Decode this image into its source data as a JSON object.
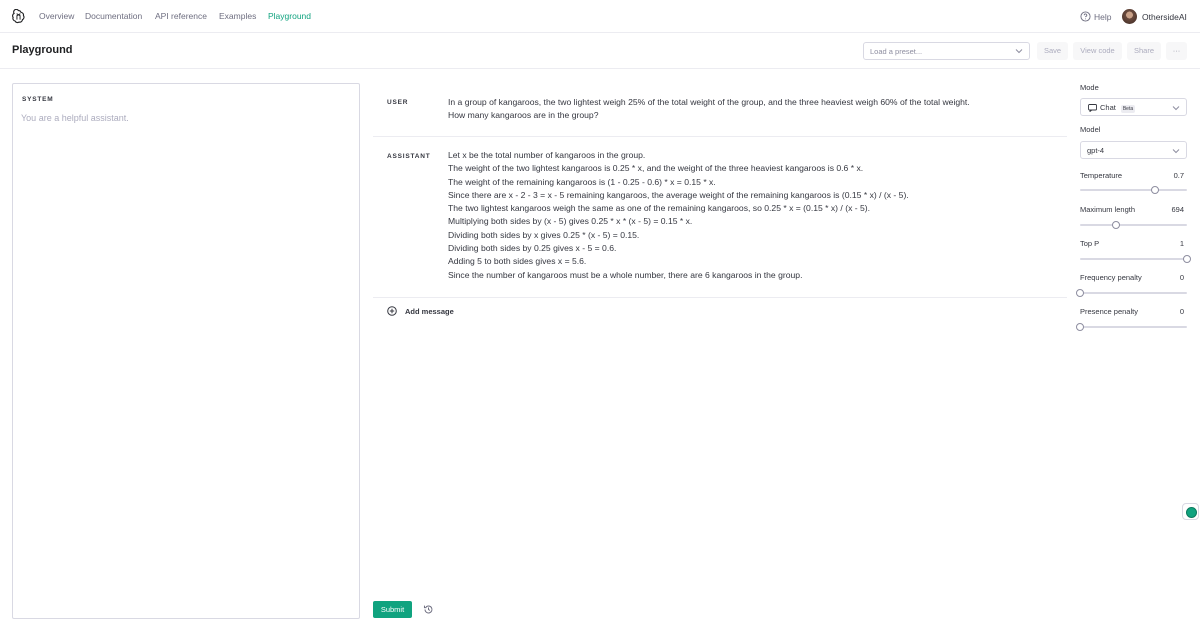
{
  "nav": {
    "links": [
      "Overview",
      "Documentation",
      "API reference",
      "Examples",
      "Playground"
    ],
    "help": "Help",
    "org": "OthersideAI"
  },
  "header": {
    "title": "Playground",
    "preset_placeholder": "Load a preset...",
    "save": "Save",
    "view_code": "View code",
    "share": "Share",
    "more": "···"
  },
  "system": {
    "label": "SYSTEM",
    "placeholder": "You are a helpful assistant."
  },
  "messages": [
    {
      "role": "USER",
      "lines": [
        "In a group of kangaroos, the two lightest weigh 25% of the total weight of the group, and the three heaviest weigh 60% of the total weight.",
        "How many kangaroos are in the group?"
      ]
    },
    {
      "role": "ASSISTANT",
      "lines": [
        "Let x be the total number of kangaroos in the group.",
        "The weight of the two lightest kangaroos is 0.25 * x, and the weight of the three heaviest kangaroos is 0.6 * x.",
        "The weight of the remaining kangaroos is (1 - 0.25 - 0.6) * x = 0.15 * x.",
        "Since there are x - 2 - 3 = x - 5 remaining kangaroos, the average weight of the remaining kangaroos is (0.15 * x) / (x - 5).",
        "The two lightest kangaroos weigh the same as one of the remaining kangaroos, so 0.25 * x = (0.15 * x) / (x - 5).",
        "Multiplying both sides by (x - 5) gives 0.25 * x * (x - 5) = 0.15 * x.",
        "Dividing both sides by x gives 0.25 * (x - 5) = 0.15.",
        "Dividing both sides by 0.25 gives x - 5 = 0.6.",
        "Adding 5 to both sides gives x = 5.6.",
        "Since the number of kangaroos must be a whole number, there are 6 kangaroos in the group."
      ]
    }
  ],
  "add_message": "Add message",
  "submit": "Submit",
  "settings": {
    "mode_label": "Mode",
    "mode_value": "Chat",
    "mode_badge": "Beta",
    "model_label": "Model",
    "model_value": "gpt-4",
    "temperature": {
      "label": "Temperature",
      "value": "0.7",
      "fraction": 0.7
    },
    "max_length": {
      "label": "Maximum length",
      "value": "694",
      "fraction": 0.34
    },
    "top_p": {
      "label": "Top P",
      "value": "1",
      "fraction": 1.0
    },
    "frequency_penalty": {
      "label": "Frequency penalty",
      "value": "0",
      "fraction": 0.0
    },
    "presence_penalty": {
      "label": "Presence penalty",
      "value": "0",
      "fraction": 0.0
    }
  },
  "colors": {
    "accent": "#10a37f",
    "text": "#353740",
    "muted": "#acacbe"
  }
}
